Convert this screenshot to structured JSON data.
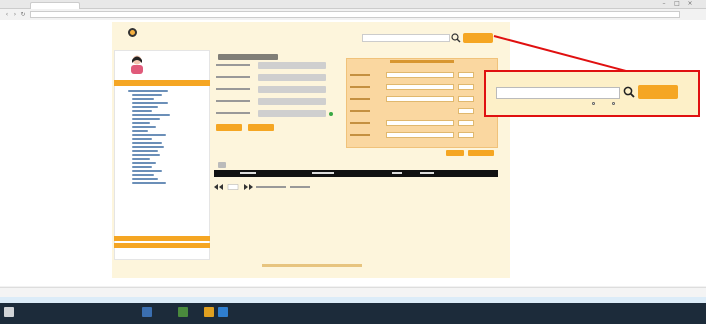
{
  "colors": {
    "accent": "#f5a623",
    "panel": "#fad7a0",
    "page_background": "#fdf5dc",
    "callout_border": "#e01010",
    "table_header": "#111111",
    "taskbar": "#1c2b3a",
    "desktop": "#dcecf8"
  },
  "icons": {
    "search": "search-icon",
    "avatar": "avatar-icon",
    "logo": "logo-icon",
    "window_minimize": "minimize-icon",
    "window_maximize": "maximize-icon",
    "window_close": "close-icon",
    "back": "back-arrow-icon",
    "forward": "forward-arrow-icon",
    "refresh": "refresh-icon",
    "pager_first": "first-page-icon",
    "pager_prev": "prev-page-icon",
    "pager_next": "next-page-icon",
    "pager_last": "last-page-icon"
  }
}
